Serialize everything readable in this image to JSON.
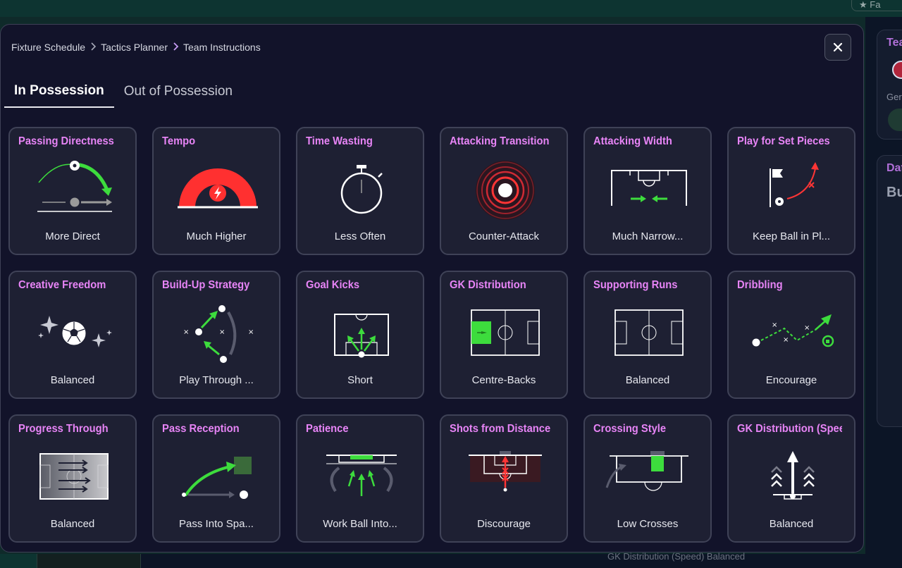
{
  "breadcrumb": {
    "items": [
      "Fixture Schedule",
      "Tactics Planner",
      "Team Instructions"
    ]
  },
  "tabs": [
    {
      "label": "In Possession",
      "active": true
    },
    {
      "label": "Out of Possession",
      "active": false
    }
  ],
  "cards": [
    {
      "title": "Passing Directness",
      "value": "More Direct",
      "icon": "passing-directness-icon"
    },
    {
      "title": "Tempo",
      "value": "Much Higher",
      "icon": "tempo-gauge-icon"
    },
    {
      "title": "Time Wasting",
      "value": "Less Often",
      "icon": "stopwatch-icon"
    },
    {
      "title": "Attacking Transition",
      "value": "Counter-Attack",
      "icon": "target-rings-icon"
    },
    {
      "title": "Attacking Width",
      "value": "Much Narrow...",
      "icon": "narrow-width-icon"
    },
    {
      "title": "Play for Set Pieces",
      "value": "Keep Ball in Pl...",
      "icon": "set-piece-flag-icon"
    },
    {
      "title": "Creative Freedom",
      "value": "Balanced",
      "icon": "sparkle-ball-icon"
    },
    {
      "title": "Build-Up Strategy",
      "value": "Play Through ...",
      "icon": "build-up-arrows-icon"
    },
    {
      "title": "Goal Kicks",
      "value": "Short",
      "icon": "goal-kick-icon"
    },
    {
      "title": "GK Distribution",
      "value": "Centre-Backs",
      "icon": "gk-distribution-pitch-icon"
    },
    {
      "title": "Supporting Runs",
      "value": "Balanced",
      "icon": "supporting-runs-pitch-icon"
    },
    {
      "title": "Dribbling",
      "value": "Encourage",
      "icon": "dribbling-path-icon"
    },
    {
      "title": "Progress Through",
      "value": "Balanced",
      "icon": "progress-through-pitch-icon"
    },
    {
      "title": "Pass Reception",
      "value": "Pass Into Spa...",
      "icon": "pass-reception-icon"
    },
    {
      "title": "Patience",
      "value": "Work Ball Into...",
      "icon": "patience-box-icon"
    },
    {
      "title": "Shots from Distance",
      "value": "Discourage",
      "icon": "shots-distance-icon"
    },
    {
      "title": "Crossing Style",
      "value": "Low Crosses",
      "icon": "crossing-style-icon"
    },
    {
      "title": "GK Distribution (Speed)",
      "value": "Balanced",
      "icon": "gk-speed-arrows-icon"
    }
  ],
  "background": {
    "side_title": "Tea",
    "side_label": "Ger",
    "side_title2": "Dat",
    "side_bold": "Bu",
    "footer_text": "GK Distribution (Speed)  Balanced",
    "favorite_label": "Fa"
  },
  "colors": {
    "accent": "#e784f6",
    "green": "#3ddc3d",
    "red": "#ff3b3b",
    "card_bg": "#1e2033",
    "modal_bg": "#12132a"
  }
}
